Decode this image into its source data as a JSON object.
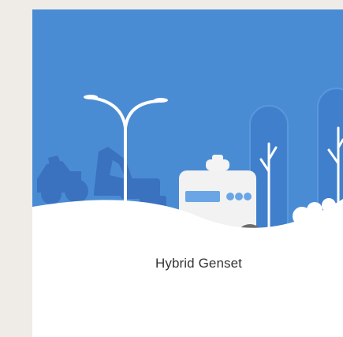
{
  "card": {
    "label": "Hybrid Genset"
  },
  "illustration": {
    "sky_color": "#4a8cd4",
    "silhouette_color": "#3a72bf",
    "ground_color": "#ffffff",
    "genset_display_color": "#6aa6e6"
  }
}
